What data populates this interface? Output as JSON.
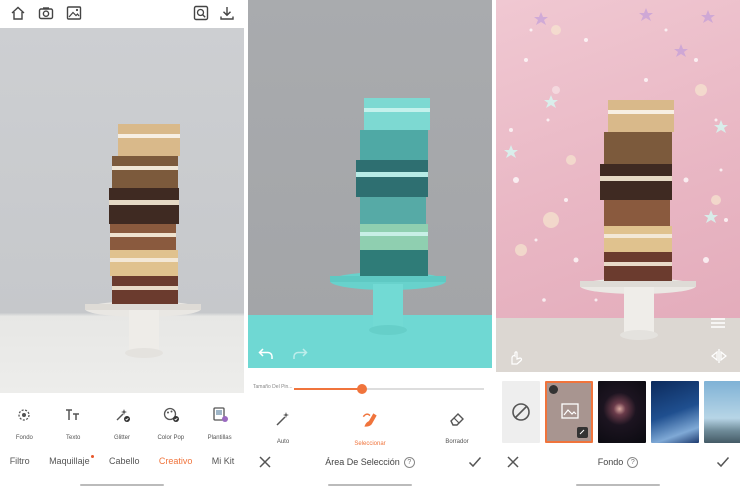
{
  "panel1": {
    "top_icons": [
      "home-icon",
      "camera-icon",
      "gallery-icon",
      "search-image-icon",
      "download-icon"
    ],
    "tools": [
      {
        "label": "Fondo",
        "icon": "background-icon"
      },
      {
        "label": "Texto",
        "icon": "text-icon"
      },
      {
        "label": "Glitter",
        "icon": "glitter-icon"
      },
      {
        "label": "Color Pop",
        "icon": "color-pop-icon"
      },
      {
        "label": "Plantillas",
        "icon": "templates-icon"
      }
    ],
    "categories": [
      {
        "label": "Filtro",
        "active": false
      },
      {
        "label": "Maquillaje",
        "active": false,
        "dot": true
      },
      {
        "label": "Cabello",
        "active": false
      },
      {
        "label": "Creativo",
        "active": true
      },
      {
        "label": "Mi Kit",
        "active": false
      }
    ]
  },
  "panel2": {
    "slider": {
      "label": "Tamaño Del Pin...",
      "value_fraction": 0.36
    },
    "tools": [
      {
        "label": "Auto",
        "icon": "magic-wand-icon",
        "active": false
      },
      {
        "label": "Seleccionar",
        "icon": "brush-select-icon",
        "active": true
      },
      {
        "label": "Borrador",
        "icon": "eraser-icon",
        "active": false
      }
    ],
    "title": "Área De Selección",
    "help": "?"
  },
  "panel3": {
    "title": "Fondo",
    "help": "?",
    "thumbnails": [
      "none",
      "custom-image",
      "nebula",
      "galaxy",
      "mountains"
    ]
  },
  "colors": {
    "accent": "#f0743c",
    "teal_selection": "#6fd8d3",
    "pink_background": "#e9b7c4"
  }
}
